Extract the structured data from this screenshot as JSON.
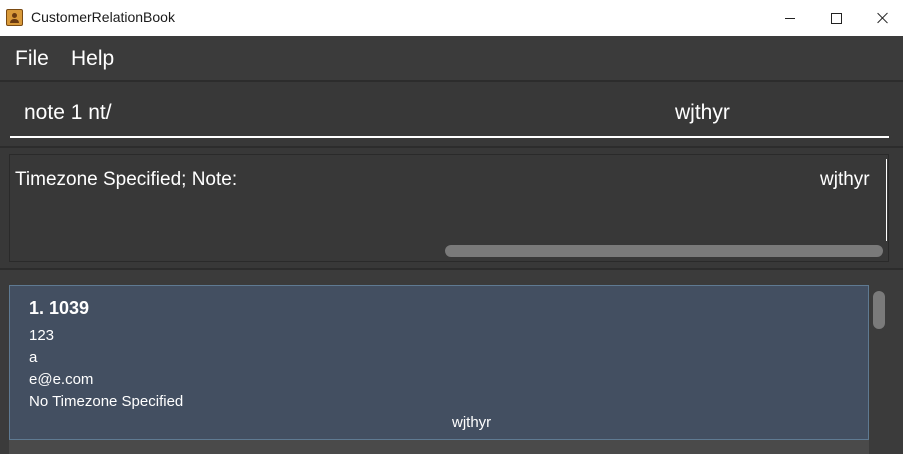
{
  "window": {
    "title": "CustomerRelationBook",
    "icon": "contact-book-icon"
  },
  "menu": {
    "items": [
      "File",
      "Help"
    ]
  },
  "command_box": {
    "text": "note 1 nt/",
    "value": "wjthyr"
  },
  "result_display": {
    "text": "Timezone Specified; Note:",
    "value": "wjthyr"
  },
  "person_list": {
    "cards": [
      {
        "title": "1. 1039",
        "phone": "123",
        "address": "a",
        "email": "e@e.com",
        "timezone": "No Timezone Specified",
        "note": "wjthyr"
      }
    ]
  },
  "colors": {
    "background": "#3b3b3b",
    "card": "#434f61",
    "card_border": "#5f7a92"
  }
}
